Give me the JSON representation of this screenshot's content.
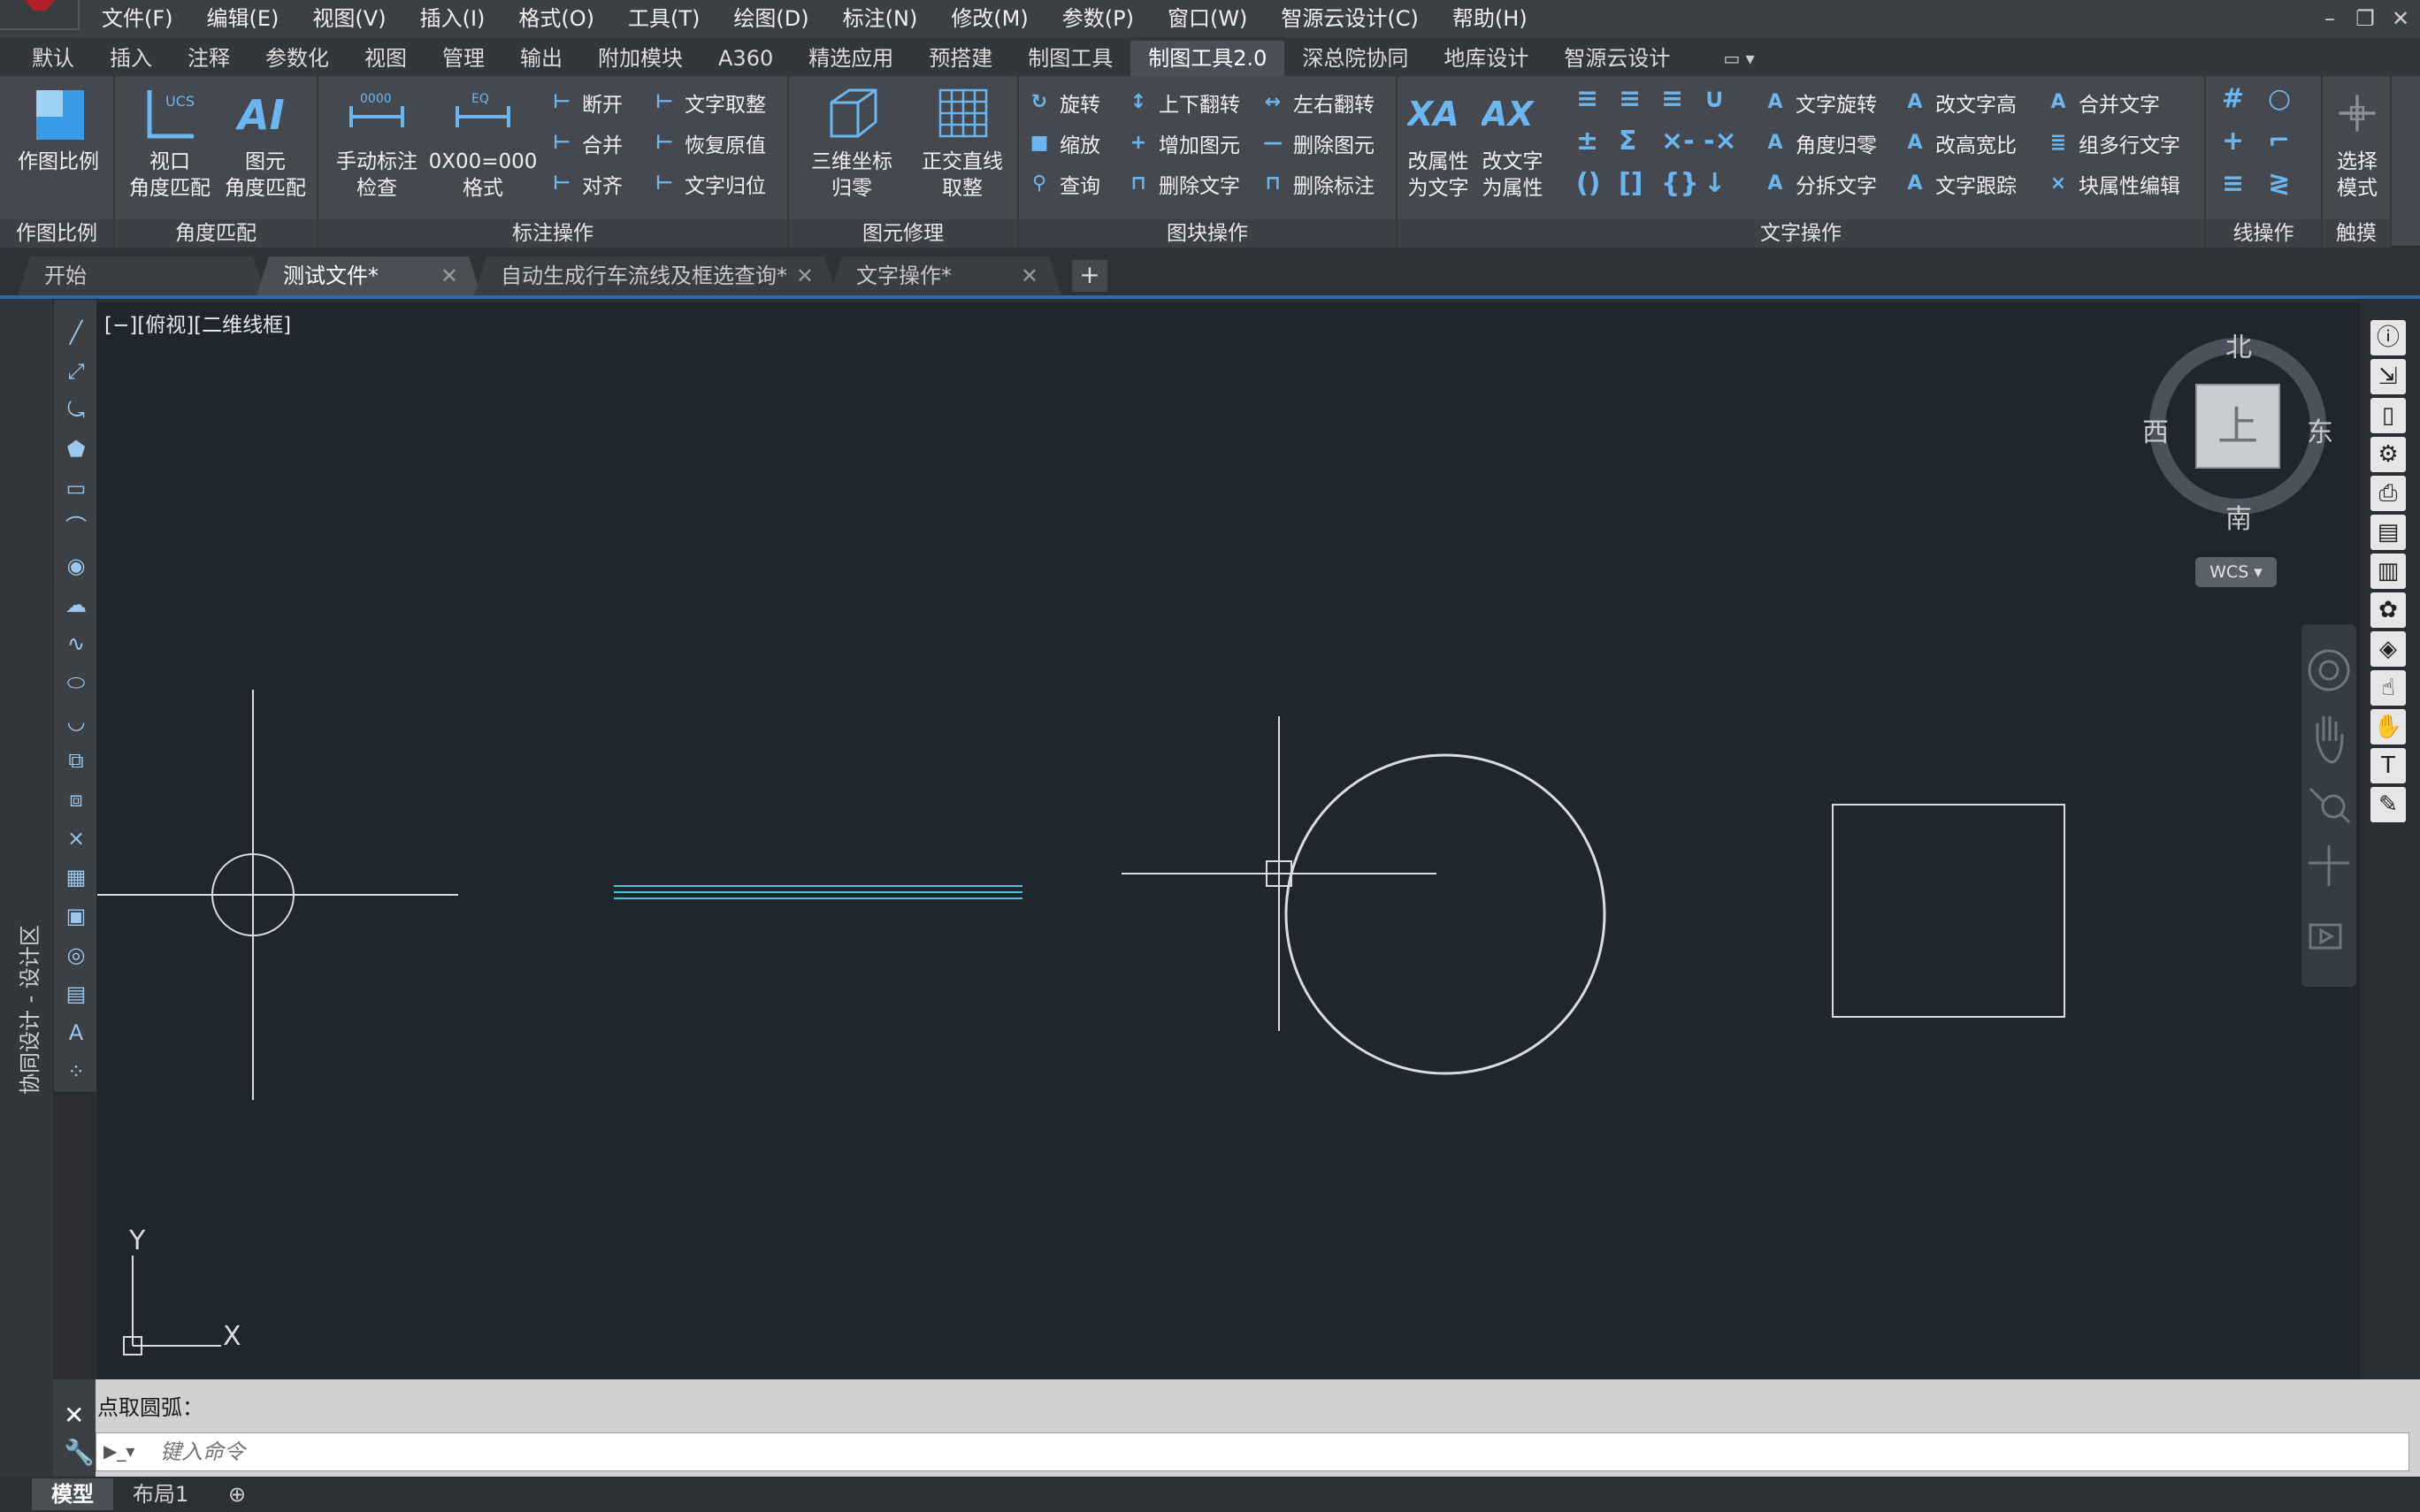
{
  "menubar": {
    "items": [
      "文件(F)",
      "编辑(E)",
      "视图(V)",
      "插入(I)",
      "格式(O)",
      "工具(T)",
      "绘图(D)",
      "标注(N)",
      "修改(M)",
      "参数(P)",
      "窗口(W)",
      "智源云设计(C)",
      "帮助(H)"
    ]
  },
  "ribbon_tabs": [
    "默认",
    "插入",
    "注释",
    "参数化",
    "视图",
    "管理",
    "输出",
    "附加模块",
    "A360",
    "精选应用",
    "预搭建",
    "制图工具",
    "制图工具2.0",
    "深总院协同",
    "地库设计",
    "智源云设计"
  ],
  "ribbon_active_tab": "制图工具2.0",
  "panels": {
    "scale": {
      "title": "作图比例",
      "btn": "作图比例"
    },
    "angle": {
      "title": "角度匹配",
      "btn1_l1": "视口",
      "btn1_l2": "角度匹配",
      "btn2_l1": "图元",
      "btn2_l2": "角度匹配"
    },
    "dim": {
      "title": "标注操作",
      "btn1_l1": "手动标注",
      "btn1_l2": "检查",
      "btn2_l1": "0X00=000",
      "btn2_l2": "格式",
      "s1": "断开",
      "s2": "合并",
      "s3": "对齐",
      "s4": "文字取整",
      "s5": "恢复原值",
      "s6": "文字归位"
    },
    "repair": {
      "title": "图元修理",
      "btn1_l1": "三维坐标",
      "btn1_l2": "归零",
      "btn2_l1": "正交直线",
      "btn2_l2": "取整"
    },
    "block": {
      "title": "图块操作",
      "s1": "旋转",
      "s2": "缩放",
      "s3": "查询",
      "s4": "上下翻转",
      "s5": "增加图元",
      "s6": "删除文字",
      "s7": "左右翻转",
      "s8": "删除图元",
      "s9": "删除标注"
    },
    "text": {
      "title": "文字操作",
      "btn1_l1": "改属性",
      "btn1_l2": "为文字",
      "btn2_l1": "改文字",
      "btn2_l2": "为属性",
      "s1": "文字旋转",
      "s2": "角度归零",
      "s3": "分拆文字",
      "s4": "改文字高",
      "s5": "改高宽比",
      "s6": "文字跟踪",
      "s7": "合并文字",
      "s8": "组多行文字",
      "s9": "块属性编辑"
    },
    "line": {
      "title": "线操作"
    },
    "touch": {
      "title": "触摸",
      "btn_l1": "选择",
      "btn_l2": "模式"
    }
  },
  "doc_tabs": [
    {
      "label": "开始"
    },
    {
      "label": "测试文件*"
    },
    {
      "label": "自动生成行车流线及框选查询*"
    },
    {
      "label": "文字操作*"
    }
  ],
  "viewport_label": "[−][俯视][二维线框]",
  "left_dock_label": "协同设计 - 设计区",
  "viewcube": {
    "north": "北",
    "south": "南",
    "east": "东",
    "west": "西",
    "face": "上",
    "wcs": "WCS"
  },
  "ucs": {
    "x": "X",
    "y": "Y"
  },
  "command": {
    "history": "点取圆弧：",
    "placeholder": "键入命令"
  },
  "layout_tabs": [
    "模型",
    "布局1"
  ],
  "colors": {
    "canvas": "#1f262e",
    "accent": "#2a6aa8",
    "icon_blue": "#6bb6ee",
    "cyan_lines": "#4fc3d8"
  }
}
